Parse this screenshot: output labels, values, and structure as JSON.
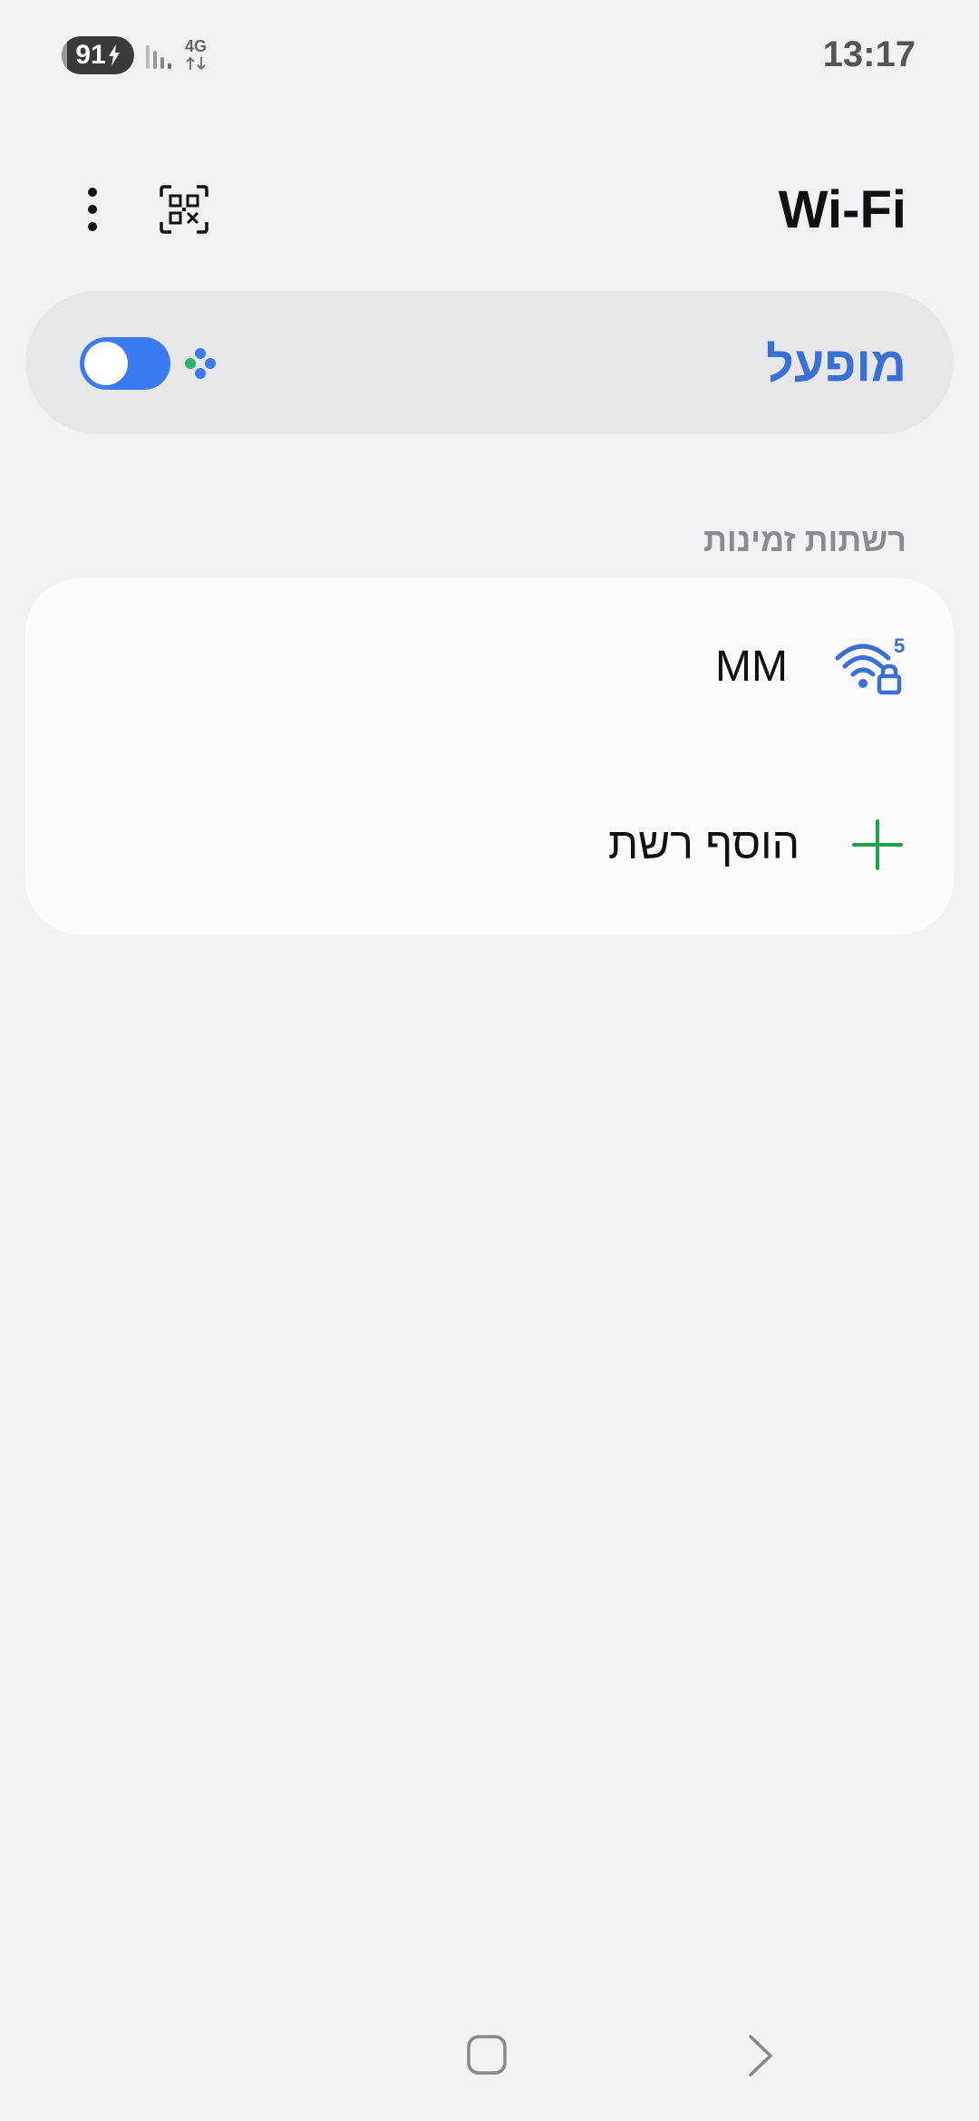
{
  "status_bar": {
    "battery": "91",
    "network_type": "4G",
    "time": "13:17",
    "icons": [
      "battery-charging-icon",
      "signal-icon",
      "data-arrows-icon"
    ]
  },
  "toolbar": {
    "title": "Wi-Fi",
    "icons": [
      "more-vert-icon",
      "qr-scan-icon"
    ]
  },
  "master_toggle": {
    "label": "מופעל",
    "checked": true,
    "accent_color": "#3a6fd8",
    "switch_color": "#3a7bf2"
  },
  "available_networks": {
    "header": "רשתות זמינות",
    "networks": [
      {
        "ssid": "MM",
        "band": "5",
        "secured": true,
        "icon": "wifi-lock-icon"
      }
    ],
    "add_network": {
      "label": "הוסף רשת",
      "icon": "plus-icon",
      "icon_color": "#1fa04a"
    }
  },
  "navigation_bar": {
    "icons": [
      "home-icon",
      "back-icon"
    ]
  }
}
